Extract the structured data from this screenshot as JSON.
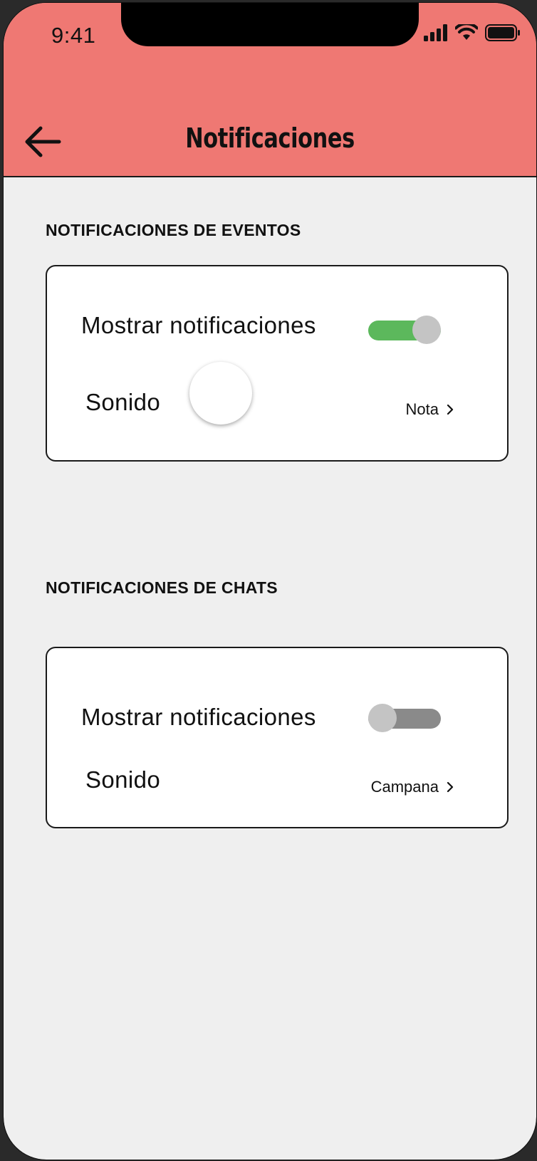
{
  "status_bar": {
    "time": "9:41",
    "icons": [
      "signal-icon",
      "wifi-icon",
      "battery-icon"
    ]
  },
  "header": {
    "title": "Notificaciones",
    "back_icon": "arrow-left-icon",
    "color": "#ef7873"
  },
  "events": {
    "section_title": "NOTIFICACIONES DE EVENTOS",
    "show_label": "Mostrar notificaciones",
    "show_enabled": true,
    "sound_label": "Sonido",
    "sound_value": "Nota"
  },
  "chats": {
    "section_title": "NOTIFICACIONES DE CHATS",
    "show_label": "Mostrar notificaciones",
    "show_enabled": false,
    "sound_label": "Sonido",
    "sound_value": "Campana"
  },
  "colors": {
    "toggle_on": "#5cb85c",
    "toggle_off": "#8a8a8a",
    "background": "#efefef"
  }
}
